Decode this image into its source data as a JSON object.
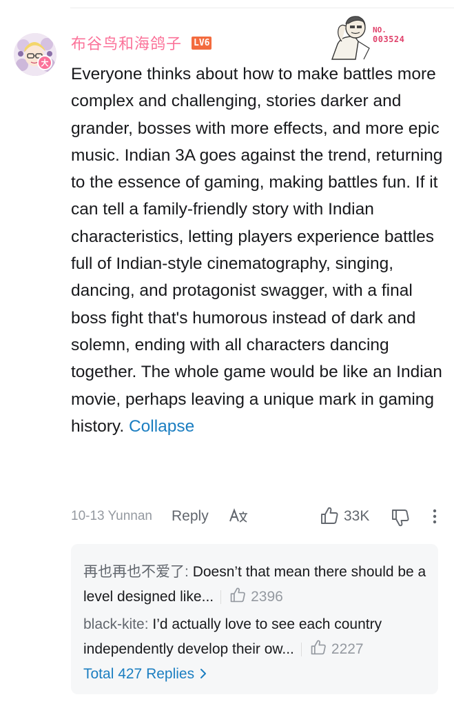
{
  "comment": {
    "username": "布谷鸟和海鸽子",
    "level": "LV6",
    "avatar_badge": "大",
    "fan_badge": {
      "label": "NO.",
      "number": "003524"
    },
    "text": "Everyone thinks about how to make battles more complex and challenging, stories darker and grander, bosses with more effects, and more epic music. Indian 3A goes against the trend, returning to the essence of gaming, making battles fun. If it can tell a family-friendly story with Indian characteristics, letting players experience battles full of Indian-style cinematography, singing, dancing, and protagonist swagger, with a final boss fight that's humorous instead of dark and solemn, ending with all characters dancing together. The whole game would be like an Indian movie, perhaps leaving a unique mark in gaming history.",
    "collapse_label": "Collapse",
    "time_location": "10-13 Yunnan",
    "reply_label": "Reply",
    "translate_icon": "translate-icon",
    "like_count": "33K"
  },
  "replies": {
    "items": [
      {
        "author": "再也再也不爱了",
        "text": "Doesn’t that mean there should be a level designed like...",
        "likes": "2396"
      },
      {
        "author": "black-kite",
        "text": "I’d actually love to see each country independently develop their ow...",
        "likes": "2227"
      }
    ],
    "total_label": "Total 427 Replies"
  },
  "colors": {
    "username": "#fb7299",
    "link": "#1b7ec1",
    "level_badge": "#f36b3e",
    "muted": "#9499a0"
  }
}
